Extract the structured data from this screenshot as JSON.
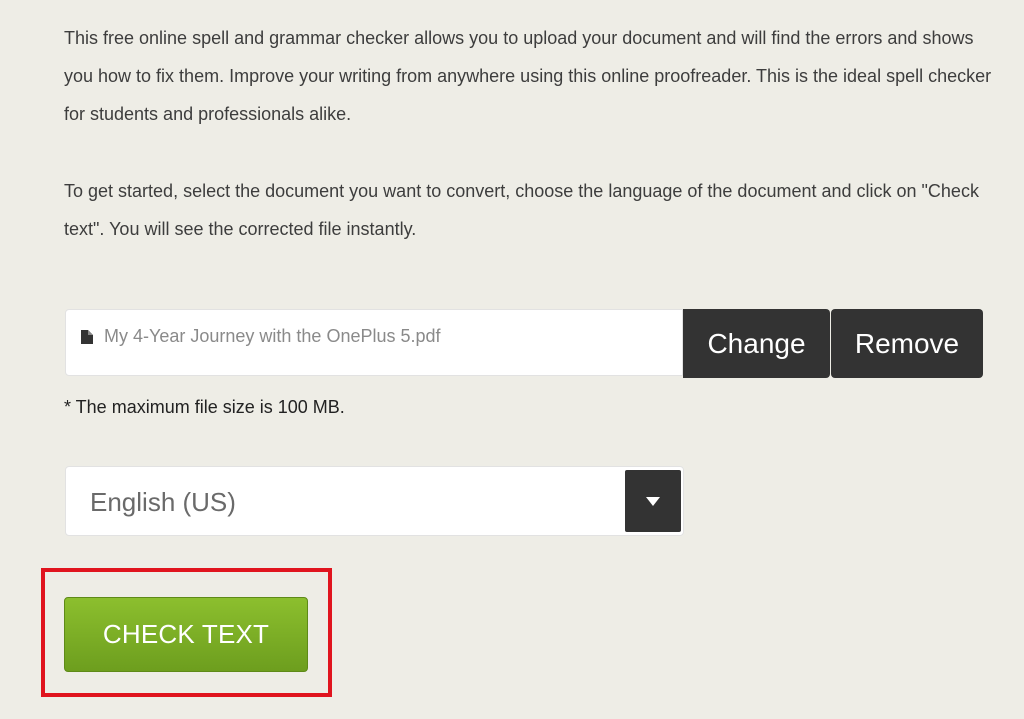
{
  "intro": {
    "paragraph1": "This free online spell and grammar checker allows you to upload your document and will find the errors and shows you how to fix them. Improve your writing from anywhere using this online proofreader. This is the ideal spell checker for students and professionals alike.",
    "paragraph2": "To get started, select the document you want to convert, choose the language of the document and click on \"Check text\". You will see the corrected file instantly."
  },
  "upload": {
    "file_icon": "file-icon",
    "file_name": "My 4-Year Journey with the OnePlus 5.pdf",
    "change_label": "Change",
    "remove_label": "Remove",
    "max_size_note": "* The maximum file size is 100 MB."
  },
  "language": {
    "selected": "English (US)",
    "arrow_icon": "caret-down-icon"
  },
  "action": {
    "check_label": "CHECK TEXT",
    "button_color": "#7cb025",
    "highlight_color": "#e0141e"
  }
}
